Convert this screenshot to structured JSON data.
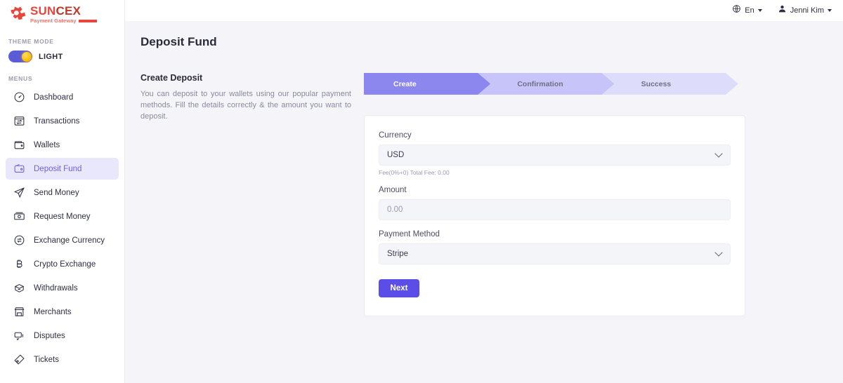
{
  "brand": {
    "name_part1": "SUN",
    "name_part2": "CEX",
    "tagline": "Payment Gateway",
    "logo_icon": "suncex-gear-logo-icon",
    "color": "#e8453c"
  },
  "sidebar": {
    "theme_section_label": "THEME MODE",
    "theme_mode": "LIGHT",
    "theme_toggle_icon": "sun-toggle-icon",
    "menus_section_label": "MENUS",
    "items": [
      {
        "label": "Dashboard",
        "icon": "speedometer-icon",
        "active": false
      },
      {
        "label": "Transactions",
        "icon": "transaction-window-icon",
        "active": false
      },
      {
        "label": "Wallets",
        "icon": "wallet-icon",
        "active": false
      },
      {
        "label": "Deposit Fund",
        "icon": "wallet-coin-icon",
        "active": true
      },
      {
        "label": "Send Money",
        "icon": "paper-plane-icon",
        "active": false
      },
      {
        "label": "Request Money",
        "icon": "money-request-icon",
        "active": false
      },
      {
        "label": "Exchange Currency",
        "icon": "exchange-arrows-icon",
        "active": false
      },
      {
        "label": "Crypto Exchange",
        "icon": "bitcoin-icon",
        "active": false
      },
      {
        "label": "Withdrawals",
        "icon": "withdraw-box-icon",
        "active": false
      },
      {
        "label": "Merchants",
        "icon": "store-icon",
        "active": false
      },
      {
        "label": "Disputes",
        "icon": "chat-bubbles-icon",
        "active": false
      },
      {
        "label": "Tickets",
        "icon": "ticket-icon",
        "active": false
      }
    ],
    "active_color": "#6c63e0",
    "active_bg": "#e9e7fb"
  },
  "topbar": {
    "language": "En",
    "language_icon": "globe-icon",
    "user_name": "Jenni Kim",
    "user_icon": "user-avatar-icon",
    "caret_icon": "caret-down-icon"
  },
  "page": {
    "title": "Deposit Fund"
  },
  "intro": {
    "heading": "Create Deposit",
    "description": "You can deposit to your wallets using our popular payment methods. Fill the details correctly & the amount you want to deposit."
  },
  "stepper": {
    "steps": [
      {
        "label": "Create",
        "state": "active"
      },
      {
        "label": "Confirmation",
        "state": "upcoming"
      },
      {
        "label": "Success",
        "state": "upcoming"
      }
    ],
    "active_color": "#8b87ee",
    "next_color": "#c7c4f9",
    "last_color": "#dedcfb"
  },
  "form": {
    "currency_label": "Currency",
    "currency_value": "USD",
    "fee_note": "Fee(0%+0) Total Fee: 0.00",
    "amount_label": "Amount",
    "amount_value": "",
    "amount_placeholder": "0.00",
    "payment_method_label": "Payment Method",
    "payment_method_value": "Stripe",
    "submit_label": "Next",
    "submit_color": "#5b4ee8",
    "dropdown_icon": "chevron-down-icon"
  }
}
